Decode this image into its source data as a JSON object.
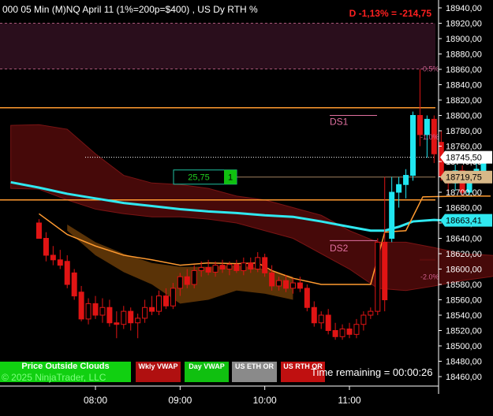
{
  "header": {
    "title": "000 05 Min (M)NQ  April 11 (1%=200p=$400) , US Dy RTH %",
    "pnl": "D -1,13% = -214,75"
  },
  "buttons": {
    "price_outside_clouds": "Price Outside Clouds",
    "weekly_vwap": "Wkly VWAP",
    "day_vwap": "Day VWAP",
    "us_eth_or": "US ETH OR",
    "us_rth_or": "US RTH OR"
  },
  "footer": {
    "copyright": "© 2025 NinjaTrader, LLC",
    "time_remaining": "Time remaining = 00:00:26"
  },
  "order_box": {
    "quantity_value": "25,75",
    "count": "1"
  },
  "colors": {
    "background": "#000000",
    "bull_candle": "#20e6f0",
    "bear_candle": "#e01414",
    "bull_dim": "#4ab8c0",
    "vwap": "#30e8f0",
    "orange_line": "#ff9a30",
    "cloud_dark_red": "#5a0c0c",
    "cloud_brown": "#6a3c08",
    "pink_label": "#e070a0",
    "price_axis_bg": "#000000"
  },
  "chart_data": {
    "type": "candlestick",
    "ylim": [
      18450,
      18950
    ],
    "y_ticks": [
      "18940,00",
      "18920,00",
      "18900,00",
      "18880,00",
      "18860,00",
      "18840,00",
      "18820,00",
      "18800,00",
      "18780,00",
      "18760,00",
      "18740,00",
      "18720,00",
      "18700,00",
      "18680,00",
      "18660,00",
      "18640,00",
      "18620,00",
      "18600,00",
      "18580,00",
      "18560,00",
      "18540,00",
      "18520,00",
      "18500,00",
      "18480,00",
      "18460,00"
    ],
    "x_ticks": [
      "08:00",
      "09:00",
      "10:00",
      "11:00"
    ],
    "time_start_min": 440,
    "bar_minutes": 5,
    "price_labels": [
      {
        "name": "last-price",
        "value": 18745.5,
        "text": "18745,50",
        "style": "white"
      },
      {
        "name": "level-price",
        "value": 18719.75,
        "text": "18719,75",
        "style": "tan"
      },
      {
        "name": "vwap-price",
        "value": 18663.41,
        "text": "18663,41",
        "style": "cyan"
      }
    ],
    "percent_levels": [
      {
        "text": "-0.5%",
        "value": 18860.5
      },
      {
        "text": "-1.0%",
        "value": 18772
      },
      {
        "text": "-2.0%",
        "value": 18590
      }
    ],
    "annotations": [
      {
        "text": "DS1",
        "value": 18792
      },
      {
        "text": "DS2",
        "value": 18627
      }
    ],
    "horizontal_levels": [
      {
        "name": "upper-orange-level",
        "value": 18810
      },
      {
        "name": "lower-orange-level",
        "value": 18690
      },
      {
        "name": "current-price-dotted",
        "value": 18745.5
      },
      {
        "name": "order-level",
        "value": 18719.75
      }
    ],
    "candles": [
      {
        "t": 440,
        "o": 18660,
        "h": 18665,
        "l": 18640,
        "c": 18640
      },
      {
        "t": 445,
        "o": 18640,
        "h": 18648,
        "l": 18610,
        "c": 18618
      },
      {
        "t": 450,
        "o": 18618,
        "h": 18630,
        "l": 18605,
        "c": 18612
      },
      {
        "t": 455,
        "o": 18612,
        "h": 18625,
        "l": 18600,
        "c": 18605
      },
      {
        "t": 460,
        "o": 18610,
        "h": 18618,
        "l": 18575,
        "c": 18580
      },
      {
        "t": 465,
        "o": 18595,
        "h": 18600,
        "l": 18560,
        "c": 18565
      },
      {
        "t": 470,
        "o": 18570,
        "h": 18578,
        "l": 18532,
        "c": 18535
      },
      {
        "t": 475,
        "o": 18535,
        "h": 18562,
        "l": 18528,
        "c": 18555
      },
      {
        "t": 480,
        "o": 18555,
        "h": 18565,
        "l": 18535,
        "c": 18540
      },
      {
        "t": 485,
        "o": 18540,
        "h": 18562,
        "l": 18530,
        "c": 18550
      },
      {
        "t": 490,
        "o": 18550,
        "h": 18560,
        "l": 18525,
        "c": 18530
      },
      {
        "t": 495,
        "o": 18530,
        "h": 18545,
        "l": 18510,
        "c": 18528
      },
      {
        "t": 500,
        "o": 18528,
        "h": 18552,
        "l": 18522,
        "c": 18545
      },
      {
        "t": 505,
        "o": 18545,
        "h": 18550,
        "l": 18520,
        "c": 18530
      },
      {
        "t": 510,
        "o": 18530,
        "h": 18542,
        "l": 18510,
        "c": 18536
      },
      {
        "t": 515,
        "o": 18536,
        "h": 18560,
        "l": 18530,
        "c": 18550
      },
      {
        "t": 520,
        "o": 18550,
        "h": 18565,
        "l": 18540,
        "c": 18545
      },
      {
        "t": 525,
        "o": 18545,
        "h": 18572,
        "l": 18540,
        "c": 18565
      },
      {
        "t": 530,
        "o": 18565,
        "h": 18575,
        "l": 18548,
        "c": 18552
      },
      {
        "t": 535,
        "o": 18552,
        "h": 18582,
        "l": 18548,
        "c": 18575
      },
      {
        "t": 540,
        "o": 18575,
        "h": 18595,
        "l": 18565,
        "c": 18590
      },
      {
        "t": 545,
        "o": 18590,
        "h": 18600,
        "l": 18575,
        "c": 18580
      },
      {
        "t": 550,
        "o": 18580,
        "h": 18605,
        "l": 18575,
        "c": 18598
      },
      {
        "t": 555,
        "o": 18598,
        "h": 18610,
        "l": 18590,
        "c": 18602
      },
      {
        "t": 560,
        "o": 18602,
        "h": 18612,
        "l": 18592,
        "c": 18596
      },
      {
        "t": 565,
        "o": 18596,
        "h": 18610,
        "l": 18590,
        "c": 18605
      },
      {
        "t": 570,
        "o": 18605,
        "h": 18612,
        "l": 18595,
        "c": 18600
      },
      {
        "t": 575,
        "o": 18600,
        "h": 18610,
        "l": 18592,
        "c": 18606
      },
      {
        "t": 580,
        "o": 18606,
        "h": 18612,
        "l": 18595,
        "c": 18598
      },
      {
        "t": 585,
        "o": 18598,
        "h": 18615,
        "l": 18592,
        "c": 18608
      },
      {
        "t": 590,
        "o": 18608,
        "h": 18615,
        "l": 18595,
        "c": 18600
      },
      {
        "t": 595,
        "o": 18600,
        "h": 18622,
        "l": 18596,
        "c": 18615
      },
      {
        "t": 600,
        "o": 18615,
        "h": 18620,
        "l": 18590,
        "c": 18595
      },
      {
        "t": 605,
        "o": 18595,
        "h": 18605,
        "l": 18572,
        "c": 18578
      },
      {
        "t": 610,
        "o": 18578,
        "h": 18590,
        "l": 18572,
        "c": 18585
      },
      {
        "t": 615,
        "o": 18585,
        "h": 18592,
        "l": 18570,
        "c": 18575
      },
      {
        "t": 620,
        "o": 18575,
        "h": 18588,
        "l": 18568,
        "c": 18582
      },
      {
        "t": 625,
        "o": 18582,
        "h": 18590,
        "l": 18570,
        "c": 18575
      },
      {
        "t": 630,
        "o": 18575,
        "h": 18580,
        "l": 18545,
        "c": 18550
      },
      {
        "t": 635,
        "o": 18550,
        "h": 18558,
        "l": 18525,
        "c": 18530
      },
      {
        "t": 640,
        "o": 18530,
        "h": 18545,
        "l": 18522,
        "c": 18540
      },
      {
        "t": 645,
        "o": 18540,
        "h": 18548,
        "l": 18515,
        "c": 18520
      },
      {
        "t": 650,
        "o": 18520,
        "h": 18530,
        "l": 18508,
        "c": 18512
      },
      {
        "t": 655,
        "o": 18512,
        "h": 18528,
        "l": 18508,
        "c": 18522
      },
      {
        "t": 660,
        "o": 18522,
        "h": 18530,
        "l": 18510,
        "c": 18515
      },
      {
        "t": 665,
        "o": 18515,
        "h": 18535,
        "l": 18510,
        "c": 18528
      },
      {
        "t": 670,
        "o": 18528,
        "h": 18545,
        "l": 18520,
        "c": 18540
      },
      {
        "t": 675,
        "o": 18540,
        "h": 18550,
        "l": 18535,
        "c": 18545
      },
      {
        "t": 680,
        "o": 18545,
        "h": 18640,
        "l": 18540,
        "c": 18635
      },
      {
        "t": 685,
        "o": 18635,
        "h": 18720,
        "l": 18545,
        "c": 18560
      },
      {
        "t": 690,
        "o": 18640,
        "h": 18720,
        "l": 18635,
        "c": 18700
      },
      {
        "t": 695,
        "o": 18700,
        "h": 18720,
        "l": 18680,
        "c": 18710
      },
      {
        "t": 700,
        "o": 18710,
        "h": 18730,
        "l": 18692,
        "c": 18722
      },
      {
        "t": 705,
        "o": 18722,
        "h": 18805,
        "l": 18715,
        "c": 18800
      },
      {
        "t": 710,
        "o": 18800,
        "h": 18860,
        "l": 18760,
        "c": 18775
      },
      {
        "t": 715,
        "o": 18775,
        "h": 18800,
        "l": 18745,
        "c": 18795
      },
      {
        "t": 720,
        "o": 18795,
        "h": 18800,
        "l": 18738,
        "c": 18750
      },
      {
        "t": 725,
        "o": 18765,
        "h": 18780,
        "l": 18715,
        "c": 18720
      },
      {
        "t": 730,
        "o": 18720,
        "h": 18728,
        "l": 18698,
        "c": 18712
      },
      {
        "t": 735,
        "o": 18712,
        "h": 18736,
        "l": 18702,
        "c": 18728
      },
      {
        "t": 740,
        "o": 18728,
        "h": 18735,
        "l": 18695,
        "c": 18700
      },
      {
        "t": 745,
        "o": 18700,
        "h": 18726,
        "l": 18696,
        "c": 18722
      },
      {
        "t": 750,
        "o": 18722,
        "h": 18738,
        "l": 18712,
        "c": 18730
      },
      {
        "t": 755,
        "o": 18728,
        "h": 18752,
        "l": 18724,
        "c": 18745.5
      }
    ],
    "series": [
      {
        "name": "vwap",
        "color": "#30e8f0",
        "points": [
          [
            420,
            18713
          ],
          [
            440,
            18706
          ],
          [
            460,
            18698
          ],
          [
            480,
            18692
          ],
          [
            500,
            18686
          ],
          [
            520,
            18682
          ],
          [
            540,
            18678
          ],
          [
            560,
            18675
          ],
          [
            580,
            18673
          ],
          [
            600,
            18670
          ],
          [
            620,
            18668
          ],
          [
            640,
            18662
          ],
          [
            660,
            18655
          ],
          [
            675,
            18650
          ],
          [
            685,
            18650
          ],
          [
            695,
            18655
          ],
          [
            705,
            18662
          ],
          [
            720,
            18664
          ],
          [
            740,
            18662
          ],
          [
            760,
            18663
          ]
        ]
      },
      {
        "name": "orange-band",
        "color": "#ff9a30",
        "points": [
          [
            440,
            18672
          ],
          [
            460,
            18645
          ],
          [
            480,
            18630
          ],
          [
            500,
            18618
          ],
          [
            520,
            18612
          ],
          [
            540,
            18605
          ],
          [
            560,
            18608
          ],
          [
            580,
            18607
          ],
          [
            595,
            18608
          ],
          [
            605,
            18598
          ],
          [
            620,
            18588
          ],
          [
            640,
            18580
          ],
          [
            660,
            18580
          ],
          [
            675,
            18580
          ],
          [
            685,
            18648
          ],
          [
            700,
            18650
          ],
          [
            712,
            18694
          ],
          [
            740,
            18695
          ],
          [
            760,
            18695
          ]
        ]
      }
    ],
    "clouds": [
      {
        "name": "red-cloud",
        "upper": [
          [
            420,
            18787
          ],
          [
            440,
            18788
          ],
          [
            460,
            18782
          ],
          [
            480,
            18750
          ],
          [
            500,
            18722
          ],
          [
            520,
            18712
          ],
          [
            540,
            18710
          ],
          [
            560,
            18705
          ],
          [
            580,
            18695
          ],
          [
            600,
            18690
          ],
          [
            620,
            18680
          ],
          [
            640,
            18670
          ],
          [
            660,
            18650
          ],
          [
            680,
            18635
          ],
          [
            700,
            18635
          ],
          [
            720,
            18628
          ],
          [
            740,
            18620
          ],
          [
            760,
            18618
          ],
          [
            780,
            18615
          ]
        ],
        "lower": [
          [
            420,
            18705
          ],
          [
            440,
            18704
          ],
          [
            460,
            18690
          ],
          [
            480,
            18678
          ],
          [
            500,
            18672
          ],
          [
            520,
            18668
          ],
          [
            540,
            18668
          ],
          [
            560,
            18665
          ],
          [
            580,
            18660
          ],
          [
            600,
            18650
          ],
          [
            620,
            18640
          ],
          [
            640,
            18620
          ],
          [
            660,
            18600
          ],
          [
            680,
            18575
          ],
          [
            700,
            18572
          ],
          [
            720,
            18578
          ],
          [
            740,
            18585
          ],
          [
            760,
            18590
          ],
          [
            780,
            18598
          ]
        ]
      },
      {
        "name": "brown-cloud",
        "upper": [
          [
            460,
            18658
          ],
          [
            480,
            18635
          ],
          [
            500,
            18620
          ],
          [
            520,
            18608
          ],
          [
            540,
            18603
          ],
          [
            560,
            18603
          ],
          [
            580,
            18605
          ],
          [
            600,
            18600
          ],
          [
            620,
            18590
          ]
        ],
        "lower": [
          [
            460,
            18650
          ],
          [
            480,
            18618
          ],
          [
            500,
            18596
          ],
          [
            520,
            18580
          ],
          [
            540,
            18555
          ],
          [
            560,
            18560
          ],
          [
            580,
            18572
          ],
          [
            600,
            18568
          ],
          [
            620,
            18560
          ]
        ]
      }
    ]
  }
}
